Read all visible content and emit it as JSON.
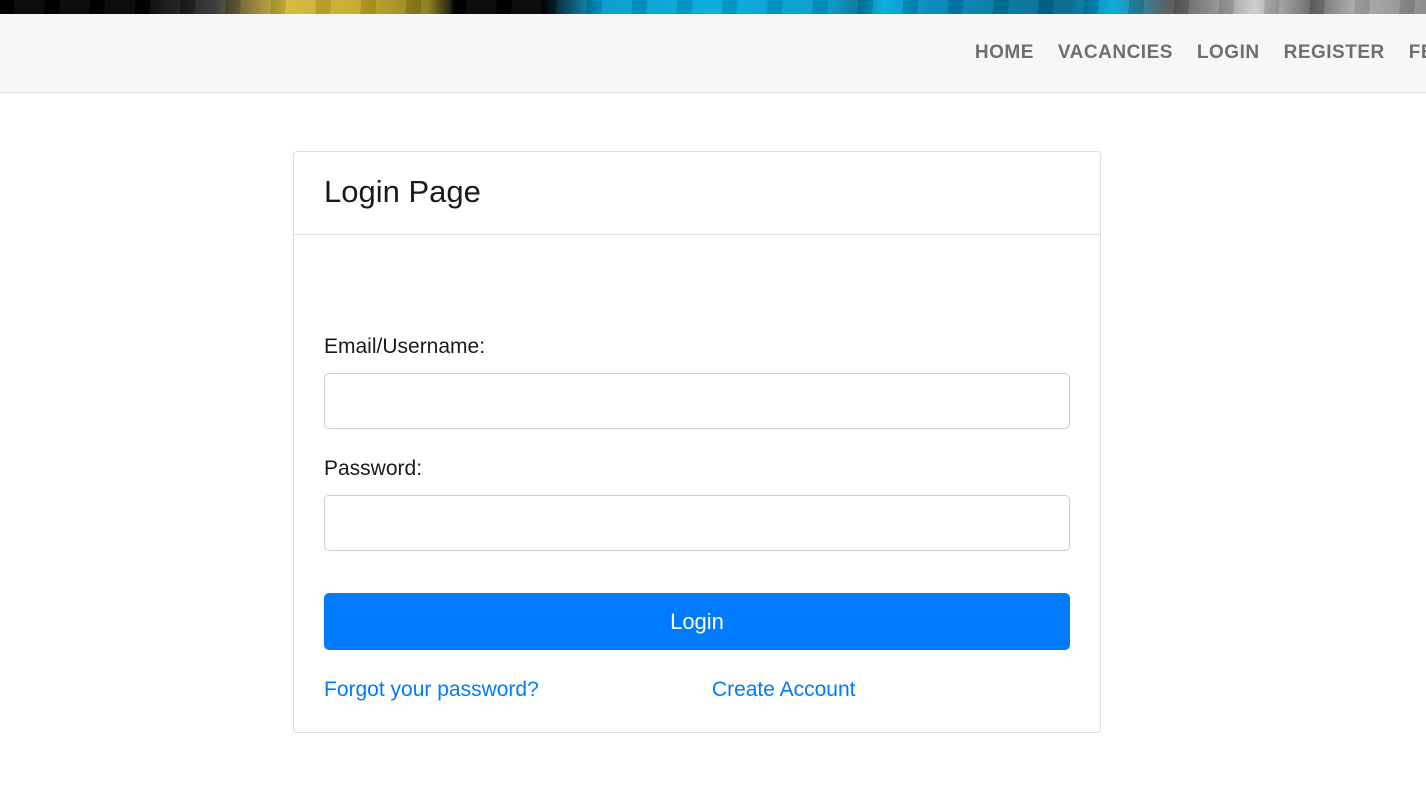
{
  "nav": {
    "items": [
      {
        "label": "HOME"
      },
      {
        "label": "VACANCIES"
      },
      {
        "label": "LOGIN"
      },
      {
        "label": "REGISTER"
      },
      {
        "label": "FE"
      }
    ]
  },
  "card": {
    "title": "Login Page"
  },
  "form": {
    "username_label": "Email/Username:",
    "username_value": "",
    "password_label": "Password:",
    "password_value": "",
    "login_button": "Login",
    "forgot_link": "Forgot your password?",
    "create_link": "Create Account"
  }
}
